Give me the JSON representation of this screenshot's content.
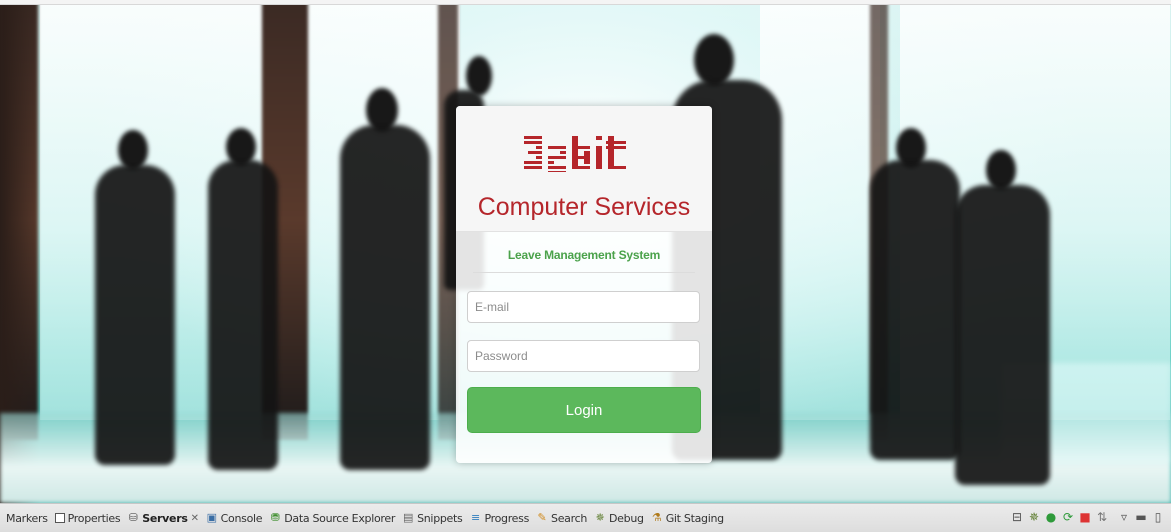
{
  "login": {
    "logo_text": "32bit",
    "company_name": "Computer Services",
    "system_name": "Leave Management System",
    "email_placeholder": "E-mail",
    "password_placeholder": "Password",
    "login_label": "Login"
  },
  "bottom_tabs": [
    {
      "label": "Markers",
      "icon": "markers-icon",
      "active": false
    },
    {
      "label": "Properties",
      "icon": "properties-icon",
      "active": false
    },
    {
      "label": "Servers",
      "icon": "servers-icon",
      "active": true
    },
    {
      "label": "Console",
      "icon": "console-icon",
      "active": false
    },
    {
      "label": "Data Source Explorer",
      "icon": "data-source-icon",
      "active": false
    },
    {
      "label": "Snippets",
      "icon": "snippets-icon",
      "active": false
    },
    {
      "label": "Progress",
      "icon": "progress-icon",
      "active": false
    },
    {
      "label": "Search",
      "icon": "search-icon",
      "active": false
    },
    {
      "label": "Debug",
      "icon": "debug-icon",
      "active": false
    },
    {
      "label": "Git Staging",
      "icon": "git-staging-icon",
      "active": false
    }
  ],
  "colors": {
    "brand_red": "#b5262b",
    "accent_green": "#5cb85c",
    "system_green": "#4ba24b"
  }
}
